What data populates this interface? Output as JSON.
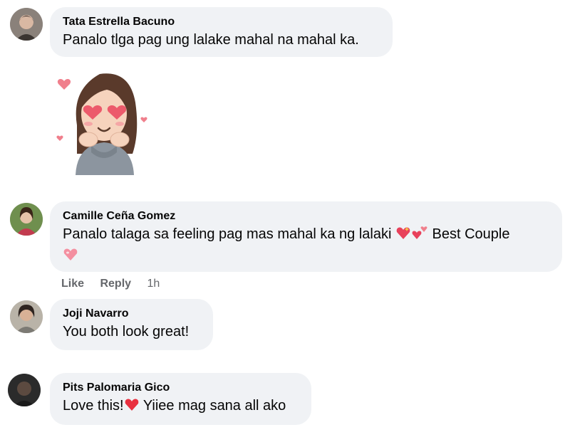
{
  "comments": [
    {
      "author": "Tata Estrella Bacuno",
      "text": "Panalo tlga pag ung lalake mahal na mahal ka."
    },
    {
      "author": "Camille Ceña Gomez",
      "text_before_emoji": "Panalo talaga sa feeling pag mas mahal ka ng lalaki",
      "text_after_emoji": "Best Couple",
      "emoji": [
        "sparkling-heart-icon",
        "revolving-hearts-icon",
        "pink-heart-icon"
      ],
      "actions": {
        "like": "Like",
        "reply": "Reply",
        "time": "1h"
      }
    },
    {
      "author": "Joji Navarro",
      "text": "You both look great!"
    },
    {
      "author": "Pits Palomaria Gico",
      "text_before_emoji": "Love this!",
      "text_after_emoji": "Yiiee mag sana all ako",
      "emoji": [
        "red-heart-icon"
      ]
    }
  ],
  "sticker": "girl-with-heart-eyes-sticker",
  "colors": {
    "bubble": "#f0f2f5",
    "author": "#050505",
    "meta": "#65676b",
    "heart": "#e8415b"
  }
}
